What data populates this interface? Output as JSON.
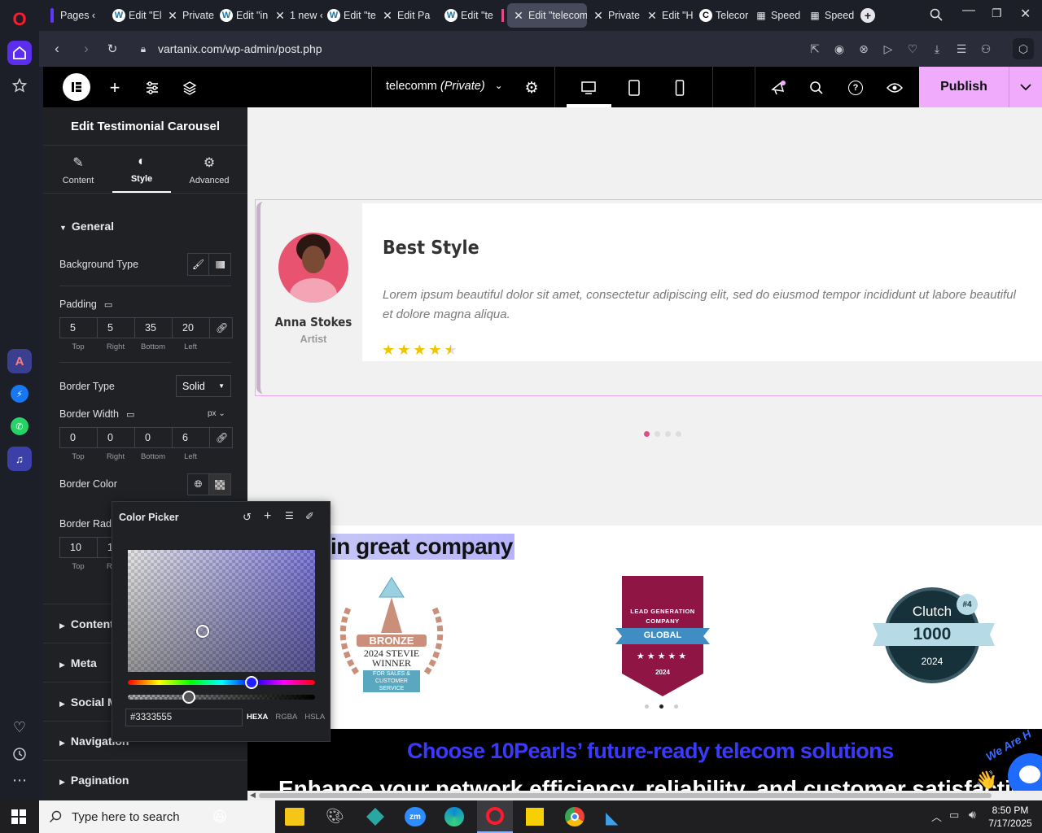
{
  "browser": {
    "tabs": [
      {
        "label": "Pages ‹",
        "icon": "purple-bar-icon"
      },
      {
        "label": "Edit \"El",
        "icon": "wordpress-icon"
      },
      {
        "label": "Private",
        "icon": "x-logo-icon"
      },
      {
        "label": "Edit \"in",
        "icon": "wordpress-icon"
      },
      {
        "label": "1 new ‹",
        "icon": "x-logo-icon"
      },
      {
        "label": "Edit \"te",
        "icon": "wordpress-icon"
      },
      {
        "label": "Edit Pa",
        "icon": "x-logo-icon"
      },
      {
        "label": "Edit \"te",
        "icon": "wordpress-icon"
      },
      {
        "label": "Edit \"telecom",
        "icon": "x-logo-icon"
      },
      {
        "label": "Private",
        "icon": "x-logo-icon"
      },
      {
        "label": "Edit \"H",
        "icon": "x-logo-icon"
      },
      {
        "label": "Telecor",
        "icon": "circle-logo-icon"
      },
      {
        "label": "Speed",
        "icon": "grid-icon"
      },
      {
        "label": "Speed",
        "icon": "grid-icon"
      }
    ],
    "new_tab": "+",
    "url": "vartanix.com/wp-admin/post.php"
  },
  "editor": {
    "page_title": "telecomm",
    "page_status": "(Private)",
    "publish_label": "Publish"
  },
  "panel": {
    "title": "Edit Testimonial Carousel",
    "tabs": {
      "content": "Content",
      "style": "Style",
      "advanced": "Advanced"
    },
    "section_general": "General",
    "background_type": "Background Type",
    "padding_label": "Padding",
    "padding": {
      "top": "5",
      "right": "5",
      "bottom": "35",
      "left": "20"
    },
    "dim_labels": {
      "top": "Top",
      "right": "Right",
      "bottom": "Bottom",
      "left": "Left"
    },
    "border_type_label": "Border Type",
    "border_type_value": "Solid",
    "border_width_label": "Border Width",
    "border_width_unit": "px",
    "border_width": {
      "top": "0",
      "right": "0",
      "bottom": "0",
      "left": "6"
    },
    "border_color_label": "Border Color",
    "border_radius_label": "Border Radi",
    "border_radius": {
      "top": "10",
      "right": "1"
    },
    "collapsed_sections": [
      "Content",
      "Meta",
      "Social M",
      "Navigation",
      "Pagination"
    ]
  },
  "picker": {
    "title": "Color Picker",
    "hex_value": "#3333555",
    "formats": [
      "HEXA",
      "RGBA",
      "HSLA"
    ],
    "base_color": "#4a43e6"
  },
  "canvas": {
    "testimonial": {
      "name": "Anna Stokes",
      "role": "Artist",
      "heading": "Best Style",
      "body": "Lorem ipsum beautiful dolor sit amet, consectetur adipiscing elit, sed do eiusmod tempor incididunt ut labore beautiful et dolore magna aliqua.",
      "rating": 4.5,
      "rating_max": 5
    },
    "company_heading": "in great company",
    "badges": [
      {
        "top": "BRONZE",
        "line1": "2024 STEVIE",
        "line2": "WINNER",
        "line3": "FOR SALES &",
        "line4": "CUSTOMER SERVICE"
      },
      {
        "top": "LEAD GENERATION",
        "sub": "COMPANY",
        "ribbon": "GLOBAL",
        "year": "2024"
      },
      {
        "top": "Clutch",
        "rank": "#4",
        "big": "1000",
        "year": "2024"
      }
    ],
    "cta_heading": "Choose 10Pearls’ future-ready telecom solutions",
    "cta_sub": "Enhance your network efficiency, reliability, and customer satisfaction",
    "wave_text": "We Are H"
  },
  "taskbar": {
    "search_placeholder": "Type here to search",
    "time": "8:50 PM",
    "date": "7/17/2025"
  },
  "colors": {
    "accent": "#f0abfc",
    "panel": "#1f2124",
    "link": "#3a3aff",
    "pink": "#e2498a"
  }
}
